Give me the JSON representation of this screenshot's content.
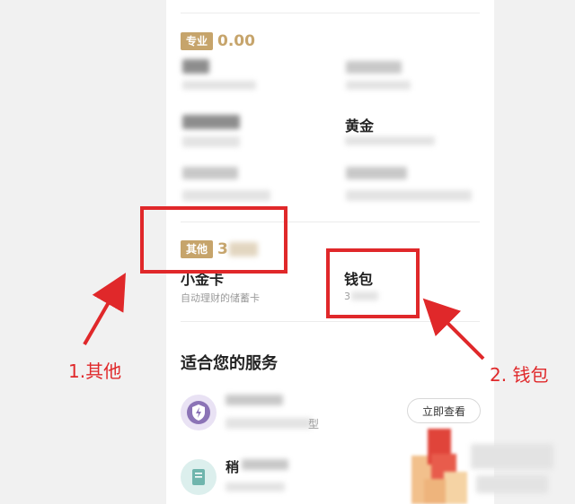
{
  "sections": {
    "pro": {
      "badge": "专业",
      "amount": "0.00"
    },
    "other": {
      "badge": "其他",
      "amount_partial": "3"
    }
  },
  "items": {
    "gold": {
      "title": "黄金"
    },
    "small_gold_card": {
      "title": "小金卡",
      "subtitle": "自动理财的储蓄卡"
    },
    "wallet": {
      "title": "钱包",
      "amount_partial": "3"
    }
  },
  "services": {
    "title": "适合您的服务",
    "view_button": "立即查看",
    "item1_partial": "型",
    "item2_partial": "稍"
  },
  "annotations": {
    "label1": "1.其他",
    "label2": "2. 钱包"
  },
  "colors": {
    "accent_gold": "#c6a46b",
    "annotation_red": "#e0282a"
  },
  "icons": [
    "shield-bolt-icon",
    "document-icon",
    "arrow-icon"
  ]
}
